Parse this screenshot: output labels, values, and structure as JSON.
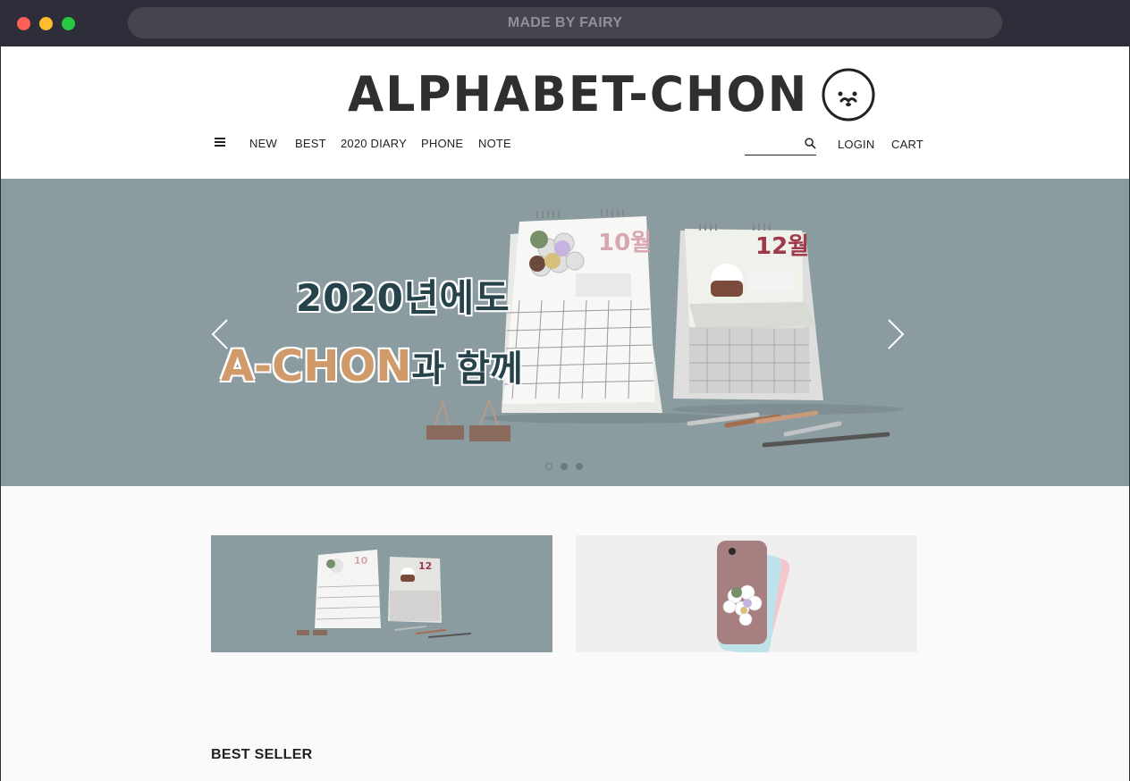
{
  "window": {
    "address": "MADE BY FAIRY"
  },
  "header": {
    "logo": "ALPHABET-CHON",
    "nav": [
      "NEW",
      "BEST",
      "2020 DIARY",
      "PHONE",
      "NOTE"
    ],
    "search_placeholder": "",
    "login": "LOGIN",
    "cart": "CART"
  },
  "banner": {
    "headline_line1": "2020년에도",
    "headline_accent": "A-CHON",
    "headline_rest": "과 함께",
    "calendar_months": [
      "10월",
      "12월"
    ],
    "slides": 3,
    "active_slide": 1,
    "background": "#8b9ca0"
  },
  "promos": {
    "items": [
      "calendar",
      "phone-case"
    ]
  },
  "sections": {
    "best_seller": "BEST SELLER"
  },
  "colors": {
    "brand_text": "#2f2f2f",
    "banner_bg": "#8b9ca0",
    "accent": "#d19a6b",
    "headline": "#26424b"
  }
}
